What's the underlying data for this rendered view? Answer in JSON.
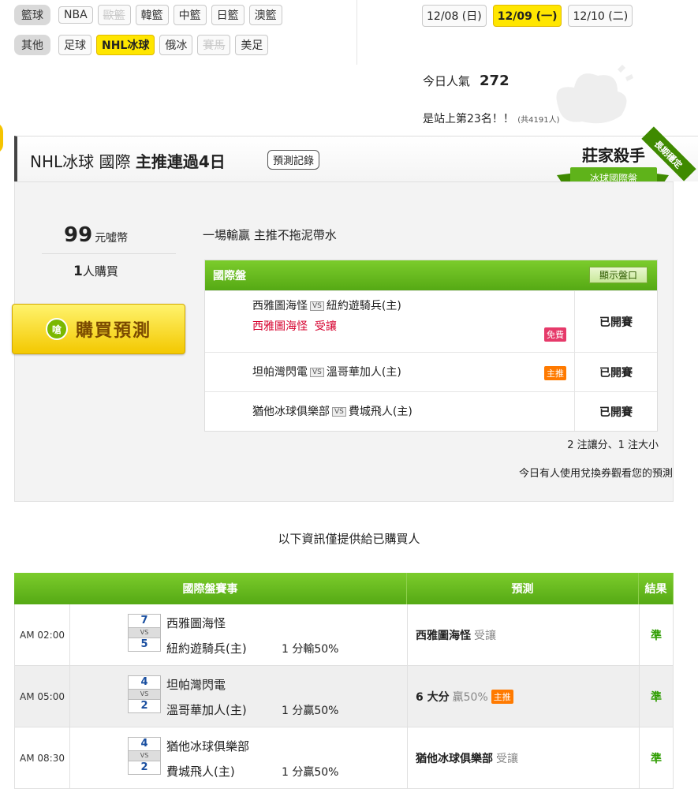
{
  "nav": {
    "row1_category": "籃球",
    "row1_items": [
      "NBA",
      "歐籃",
      "韓籃",
      "中籃",
      "日籃",
      "澳籃"
    ],
    "row2_category": "其他",
    "row2_items": [
      "足球",
      "NHL冰球",
      "俄冰",
      "賽馬",
      "美足"
    ]
  },
  "dates": [
    "12/08 (日)",
    "12/09 (一)",
    "12/10 (二)"
  ],
  "popularity": {
    "label": "今日人氣",
    "value": "272"
  },
  "rank": {
    "text": "是站上第23名！！",
    "total": "(共4191人)"
  },
  "title": {
    "league": "NHL冰球 國際",
    "streak": "主推連過4日",
    "record_button": "預測記錄"
  },
  "badge": {
    "line1": "莊家殺手",
    "line2": "冰球國際盤",
    "ribbon": "長期穩定"
  },
  "price": {
    "value": "99",
    "unit": "元噓幣"
  },
  "buyers": {
    "count": "1",
    "label": "人購買"
  },
  "buy_button": {
    "coin": "嗆",
    "label": "購買預測"
  },
  "slogan": "一場輸贏 主推不拖泥帶水",
  "games": {
    "header": "國際盤",
    "show_odds": "顯示盤口",
    "vs": "VS",
    "rows": [
      {
        "away": "西雅圖海怪",
        "home": "紐約遊騎兵(主)",
        "pick_team": "西雅圖海怪",
        "pick": "受讓",
        "tag": "免費",
        "status": "已開賽"
      },
      {
        "away": "坦帕灣閃電",
        "home": "溫哥華加人(主)",
        "tag": "主推",
        "status": "已開賽"
      },
      {
        "away": "猶他冰球俱樂部",
        "home": "費城飛人(主)",
        "status": "已開賽"
      }
    ]
  },
  "summary": "2 注讓分、1 注大小",
  "voucher_note": "今日有人使用兌換券觀看您的預測",
  "info_note": "以下資訊僅提供給已購買人",
  "results": {
    "headers": [
      "國際盤賽事",
      "預測",
      "結果"
    ],
    "vs": "VS",
    "rows": [
      {
        "time": "AM 02:00",
        "score1": "7",
        "score2": "5",
        "team1": "西雅圖海怪",
        "team2": "紐約遊騎兵(主)",
        "line": "1 分輸50%",
        "pred_main": "西雅圖海怪",
        "pred_sub": "受讓",
        "pred_tag": "",
        "result": "準"
      },
      {
        "time": "AM 05:00",
        "score1": "4",
        "score2": "2",
        "team1": "坦帕灣閃電",
        "team2": "溫哥華加人(主)",
        "line": "1 分贏50%",
        "pred_main": "6 大分",
        "pred_sub": "贏50%",
        "pred_tag": "主推",
        "result": "準"
      },
      {
        "time": "AM 08:30",
        "score1": "4",
        "score2": "2",
        "team1": "猶他冰球俱樂部",
        "team2": "費城飛人(主)",
        "line": "1 分贏50%",
        "pred_main": "猶他冰球俱樂部",
        "pred_sub": "受讓",
        "pred_tag": "",
        "result": "準"
      }
    ]
  }
}
